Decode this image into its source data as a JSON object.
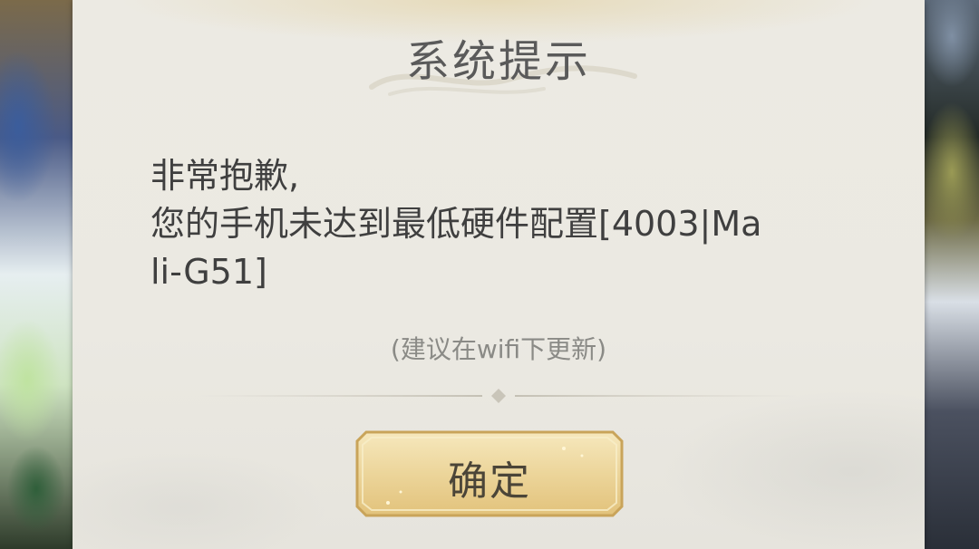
{
  "dialog": {
    "title": "系统提示",
    "message_lines": [
      "非常抱歉,",
      "您的手机未达到最低硬件配置[4003|Ma",
      "li-G51]"
    ],
    "hint": "(建议在wifi下更新)",
    "confirm_label": "确定"
  },
  "colors": {
    "panel_background": "#ebe9e2",
    "title_text": "#5a5a5a",
    "message_text": "#3f3f3f",
    "hint_text": "#8a8a86",
    "button_gold": "#ecd59a"
  }
}
